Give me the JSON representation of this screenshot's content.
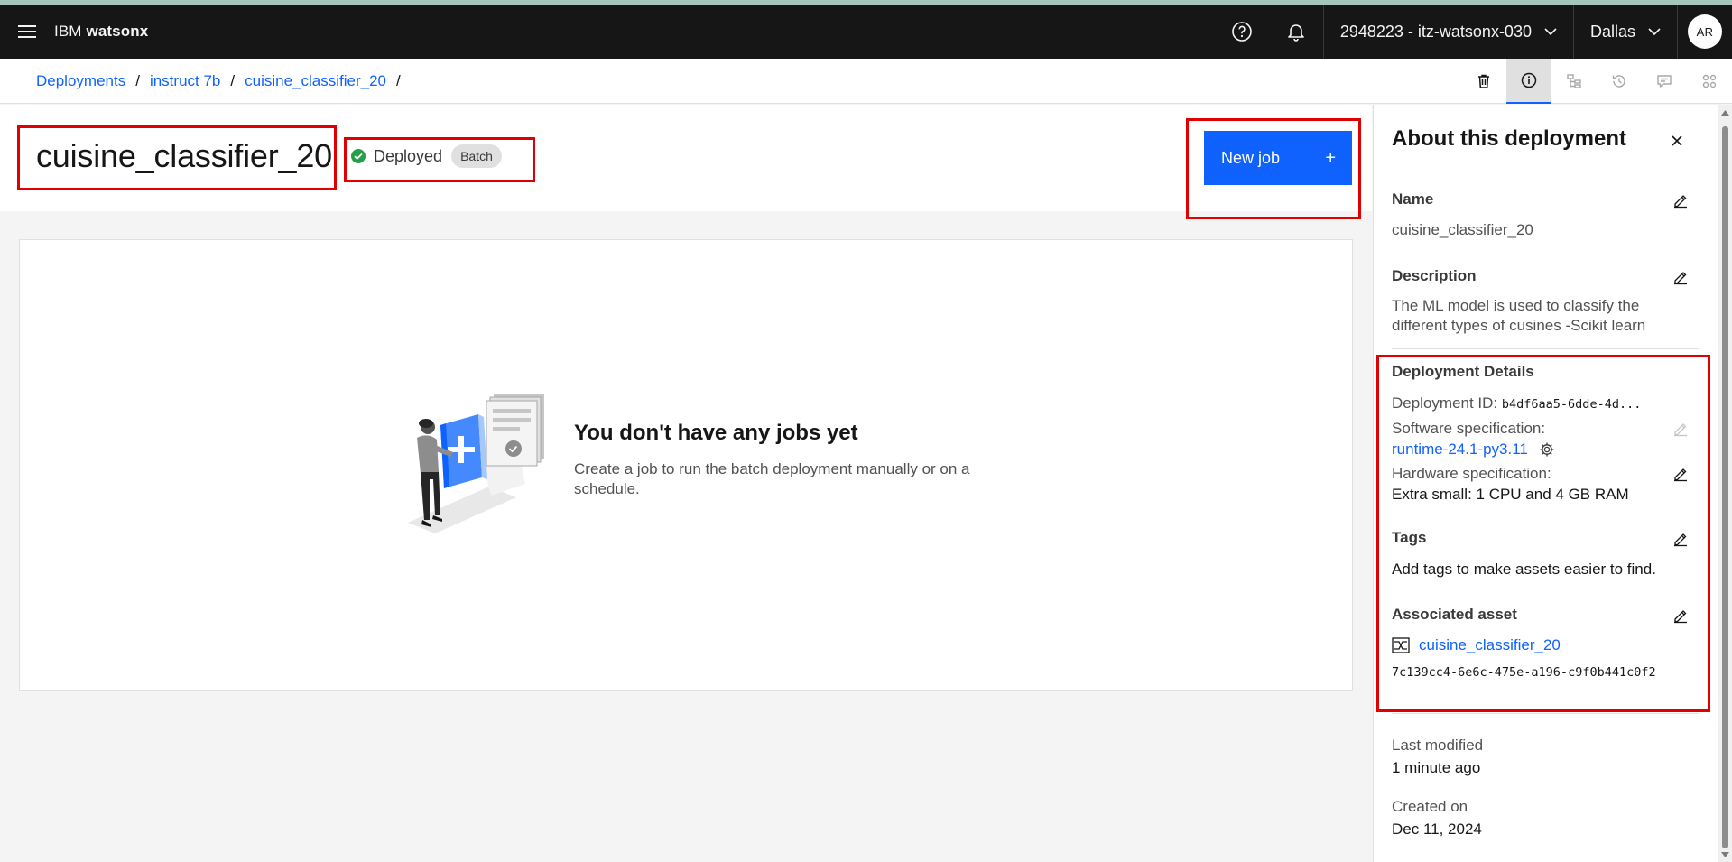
{
  "header": {
    "brand_prefix": "IBM",
    "brand_name": "watsonx",
    "account": "2948223 - itz-watsonx-030",
    "region": "Dallas",
    "avatar_initials": "AR"
  },
  "breadcrumb": {
    "items": [
      "Deployments",
      "instruct 7b",
      "cuisine_classifier_20"
    ],
    "separator": "/"
  },
  "toolbar": {
    "icons": [
      "trash-icon",
      "info-icon",
      "tree-icon",
      "history-icon",
      "comment-icon",
      "grid-icon"
    ],
    "active": "info-icon"
  },
  "page": {
    "title": "cuisine_classifier_20",
    "status": "Deployed",
    "tag": "Batch",
    "new_job_label": "New job",
    "new_job_icon": "+"
  },
  "empty_state": {
    "title": "You don't have any jobs yet",
    "description": "Create a job to run the batch deployment manually or on a schedule."
  },
  "panel": {
    "title": "About this deployment",
    "name_label": "Name",
    "name_value": "cuisine_classifier_20",
    "description_label": "Description",
    "description_value": "The ML model is used to classify the different types of cusines -Scikit learn",
    "details_label": "Deployment Details",
    "deployment_id_label": "Deployment ID:",
    "deployment_id_value": "b4df6aa5-6dde-4d...",
    "software_spec_label": "Software specification:",
    "software_spec_value": "runtime-24.1-py3.11",
    "hardware_spec_label": "Hardware specification:",
    "hardware_spec_value": "Extra small: 1 CPU and 4 GB RAM",
    "tags_label": "Tags",
    "tags_value": "Add tags to make assets easier to find.",
    "asset_label": "Associated asset",
    "asset_name": "cuisine_classifier_20",
    "asset_id": "7c139cc4-6e6c-475e-a196-c9f0b441c0f2",
    "last_modified_label": "Last modified",
    "last_modified_value": "1 minute ago",
    "created_label": "Created on",
    "created_value": "Dec 11, 2024"
  },
  "colors": {
    "accent": "#0f62fe",
    "header_bg": "#161616",
    "success": "#24a148",
    "highlight_box": "#e00000"
  }
}
